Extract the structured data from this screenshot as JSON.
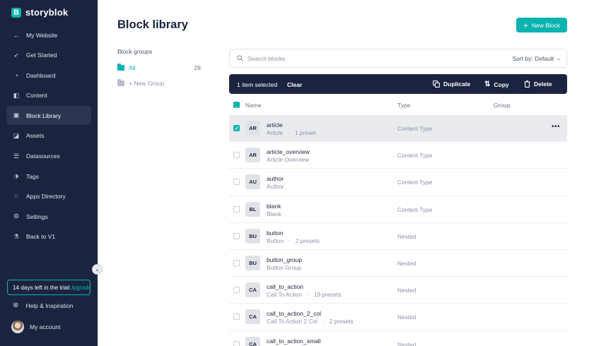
{
  "sidebar": {
    "brand": "storyblok",
    "items": [
      {
        "label": "My Website",
        "icon": "arrow-left-icon",
        "glyph": "←"
      },
      {
        "label": "Get Started",
        "icon": "rocket-icon",
        "glyph": "➶"
      },
      {
        "label": "Dashboard",
        "icon": "gauge-icon",
        "glyph": "◔"
      },
      {
        "label": "Content",
        "icon": "content-icon",
        "glyph": "◧"
      },
      {
        "label": "Block Library",
        "icon": "block-library-icon",
        "glyph": "▣"
      },
      {
        "label": "Assets",
        "icon": "assets-icon",
        "glyph": "◪"
      },
      {
        "label": "Datasources",
        "icon": "datasources-icon",
        "glyph": "☰"
      },
      {
        "label": "Tags",
        "icon": "tag-icon",
        "glyph": "⬗"
      },
      {
        "label": "Apps Directory",
        "icon": "apps-icon",
        "glyph": "⁙"
      },
      {
        "label": "Settings",
        "icon": "gear-icon",
        "glyph": "⚙"
      },
      {
        "label": "Back to V1",
        "icon": "flask-icon",
        "glyph": "⚗"
      }
    ],
    "trial": "14 days left in the trial",
    "upgrade": "Upgrade",
    "help": "Help & Inspiration",
    "account": "My account"
  },
  "header": {
    "title": "Block library",
    "new_block": "New Block"
  },
  "groups": {
    "title": "Block groups",
    "all_label": "All",
    "all_count": "28",
    "new_group": "+ New Group"
  },
  "search": {
    "placeholder": "Search blocks",
    "sort_label": "Sort by: Default"
  },
  "selection": {
    "text": "1 item selected",
    "clear": "Clear",
    "duplicate": "Duplicate",
    "copy": "Copy",
    "delete": "Delete"
  },
  "table": {
    "col_name": "Name",
    "col_type": "Type",
    "col_group": "Group",
    "rows": [
      {
        "abbr": "AR",
        "name": "article",
        "display": "Article",
        "presets": "1 preset",
        "type": "Content Type",
        "selected": true
      },
      {
        "abbr": "AR",
        "name": "article_overview",
        "display": "Article Overview",
        "presets": "",
        "type": "Content Type",
        "selected": false
      },
      {
        "abbr": "AU",
        "name": "author",
        "display": "Author",
        "presets": "",
        "type": "Content Type",
        "selected": false
      },
      {
        "abbr": "BL",
        "name": "blank",
        "display": "Blank",
        "presets": "",
        "type": "Content Type",
        "selected": false
      },
      {
        "abbr": "BU",
        "name": "button",
        "display": "Button",
        "presets": "2 presets",
        "type": "Nested",
        "selected": false
      },
      {
        "abbr": "BU",
        "name": "button_group",
        "display": "Button Group",
        "presets": "",
        "type": "Nested",
        "selected": false
      },
      {
        "abbr": "CA",
        "name": "call_to_action",
        "display": "Call To Action",
        "presets": "19 presets",
        "type": "Nested",
        "selected": false
      },
      {
        "abbr": "CA",
        "name": "call_to_action_2_col",
        "display": "Call To Action 2 Col",
        "presets": "2 presets",
        "type": "Nested",
        "selected": false
      },
      {
        "abbr": "CA",
        "name": "call_to_action_small",
        "display": "Call To Action Small",
        "presets": "",
        "type": "Nested",
        "selected": false
      }
    ]
  },
  "colors": {
    "brand": "#09b3af",
    "sidebar": "#1b243f"
  }
}
